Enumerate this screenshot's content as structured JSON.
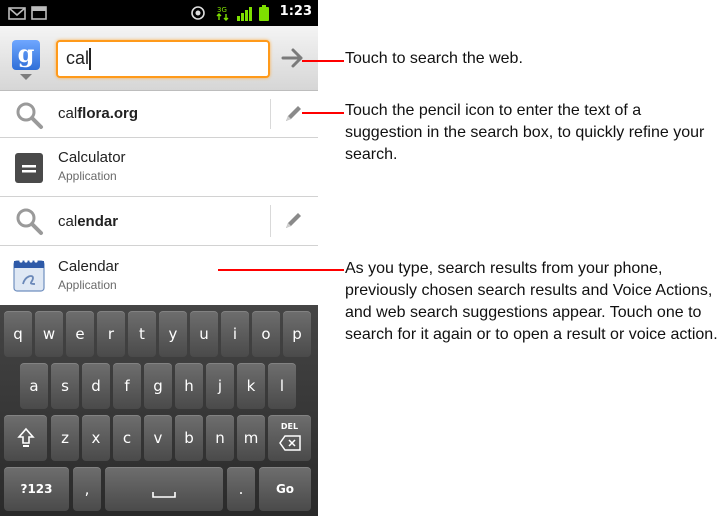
{
  "status_bar": {
    "time": "1:23",
    "icons": [
      "gmail-icon",
      "screenshot-icon",
      "gps-icon",
      "data-icon",
      "signal-icon",
      "battery-icon"
    ]
  },
  "search": {
    "source_logo": "g",
    "query": "cal",
    "go_icon": "arrow-right-icon"
  },
  "suggestions": [
    {
      "type": "web",
      "prefix": "cal",
      "rest": "flora.org",
      "icon": "magnifier-icon",
      "has_pencil": true
    },
    {
      "type": "app",
      "title": "Calculator",
      "subtitle": "Application",
      "icon": "calculator-icon",
      "has_pencil": false
    },
    {
      "type": "web",
      "prefix": "cal",
      "rest": "endar",
      "icon": "magnifier-icon",
      "has_pencil": true
    },
    {
      "type": "app",
      "title": "Calendar",
      "subtitle": "Application",
      "icon": "calendar-icon",
      "has_pencil": false
    }
  ],
  "keyboard": {
    "row1": [
      "q",
      "w",
      "e",
      "r",
      "t",
      "y",
      "u",
      "i",
      "o",
      "p"
    ],
    "row2": [
      "a",
      "s",
      "d",
      "f",
      "g",
      "h",
      "j",
      "k",
      "l"
    ],
    "row3": [
      "z",
      "x",
      "c",
      "v",
      "b",
      "n",
      "m"
    ],
    "del_label": "DEL",
    "sym_label": "?123",
    "comma_label": ",",
    "period_label": ".",
    "go_label": "Go"
  },
  "callouts": {
    "search_web": "Touch to search the web.",
    "pencil": "Touch the pencil icon to enter the text of a suggestion in the search box, to quickly refine your search.",
    "results": "As you type, search results from your phone, previously chosen search results and Voice Actions, and web search suggestions appear. Touch one to search for it again or to open a result or voice action."
  },
  "colors": {
    "callout_line": "#ff0000",
    "input_focus": "#ff9a1a",
    "status_bar": "#000000"
  }
}
